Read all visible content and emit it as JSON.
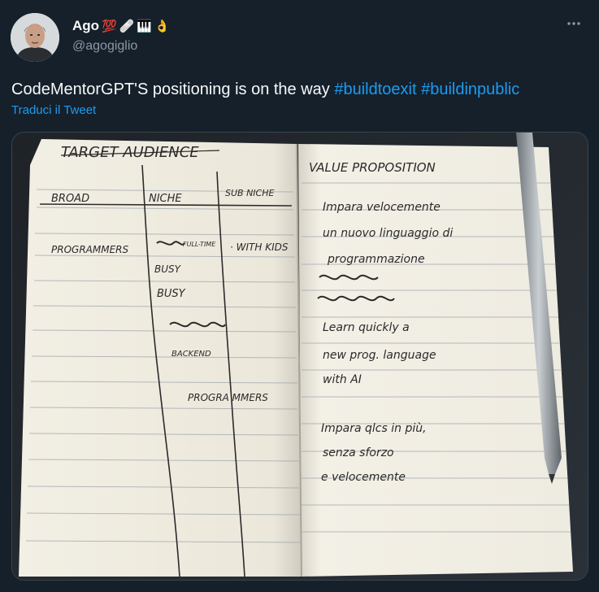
{
  "author": {
    "name": "Ago",
    "badges": [
      "💯",
      "🩹",
      "🎹",
      "👌"
    ],
    "handle": "@agogiglio",
    "avatar_icon": "avatar-photo"
  },
  "tweet": {
    "text_main": "CodeMentorGPT'S positioning is on the way",
    "hashtags": [
      "#buildtoexit",
      "#buildinpublic"
    ],
    "translate_label": "Traduci il Tweet"
  },
  "media": {
    "icon": "notebook-photo",
    "left_page": {
      "title": "TARGET AUDIENCE",
      "columns": [
        "BROAD",
        "NICHE",
        "SUB NICHE"
      ],
      "broad": "PROGRAMMERS",
      "niche": [
        "FULL-TIME",
        "BUSY",
        "BUSY",
        "BACKEND",
        "PROGRA MMERS"
      ],
      "sub_niche": "· WITH KIDS"
    },
    "right_page": {
      "title": "VALUE PROPOSITION",
      "lines": [
        "Impara velocemente",
        "un nuovo linguaggio di",
        "programmazione",
        "Learn quickly a",
        "new prog. language",
        "with AI",
        "Impara qlcs in più,",
        "senza sforzo",
        "e velocemente"
      ]
    }
  },
  "colors": {
    "background": "#15202b",
    "text": "#f7f9f9",
    "secondary": "#8b98a5",
    "link": "#1d9bf0"
  }
}
